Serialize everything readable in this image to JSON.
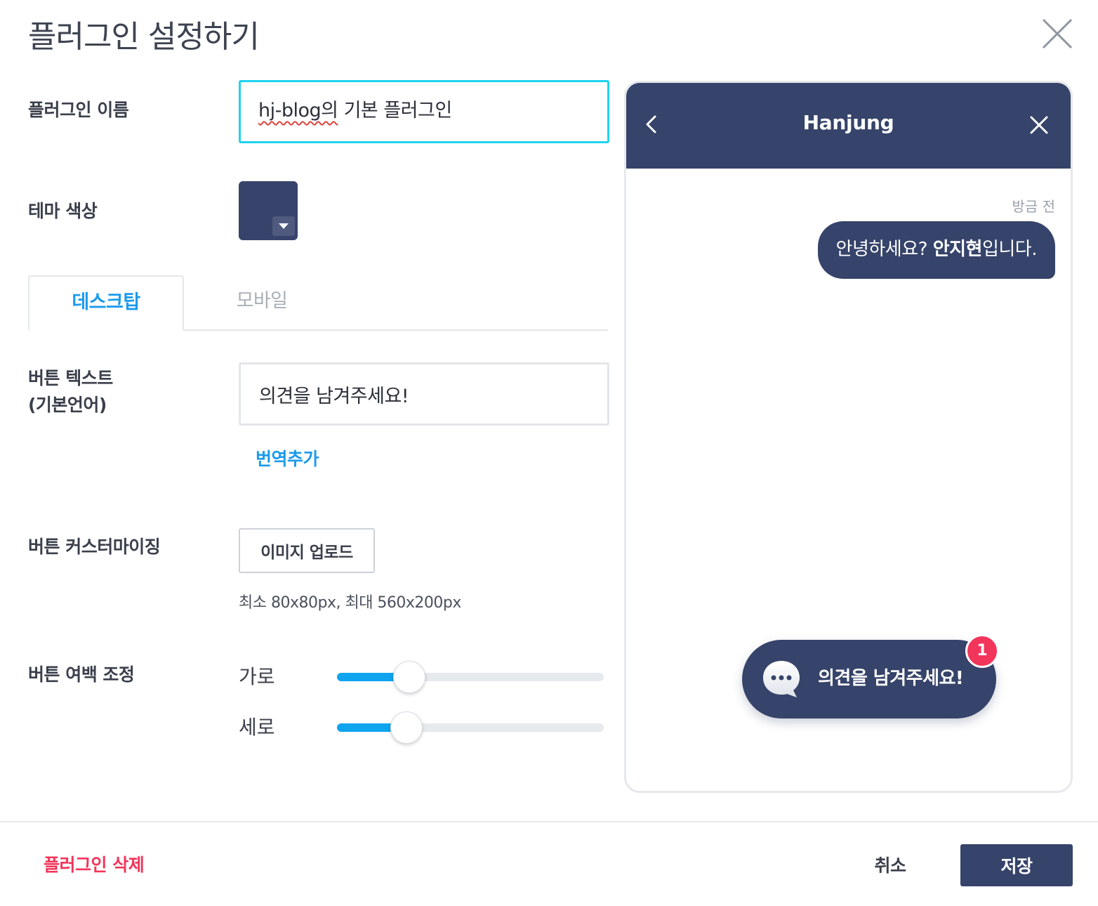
{
  "dialog": {
    "title": "플러그인 설정하기",
    "close_icon": "close-icon"
  },
  "plugin_name": {
    "label": "플러그인 이름",
    "value_misspelled": "hj-blog의",
    "value_rest": " 기본 플러그인"
  },
  "theme_color": {
    "label": "테마 색상",
    "value": "#37436a"
  },
  "tabs": [
    {
      "label": "데스크탑",
      "active": true
    },
    {
      "label": "모바일",
      "active": false
    }
  ],
  "button_text": {
    "label_line1": "버튼 텍스트",
    "label_line2": "(기본언어)",
    "value": "의견을 남겨주세요!",
    "add_translation": "번역추가"
  },
  "button_custom": {
    "label": "버튼 커스터마이징",
    "upload_label": "이미지 업로드",
    "hint": "최소 80x80px, 최대 560x200px"
  },
  "button_margin": {
    "label": "버튼 여백 조정",
    "horizontal_label": "가로",
    "horizontal_fraction": 0.27,
    "vertical_label": "세로",
    "vertical_fraction": 0.26
  },
  "preview": {
    "header_title": "Hanjung",
    "back_icon": "chevron-left-icon",
    "close_icon": "close-icon",
    "timestamp": "방금 전",
    "message_pre": "안녕하세요? ",
    "message_bold": "안지현",
    "message_post": "입니다.",
    "launcher_text": "의견을 남겨주세요!",
    "launcher_icon": "chat-bubble-icon",
    "badge_count": "1"
  },
  "footer": {
    "delete_label": "플러그인 삭제",
    "cancel_label": "취소",
    "save_label": "저장"
  },
  "colors": {
    "accent": "#1b9bec",
    "focus": "#1fd3ef",
    "brand": "#36436a",
    "danger": "#f2355b"
  }
}
